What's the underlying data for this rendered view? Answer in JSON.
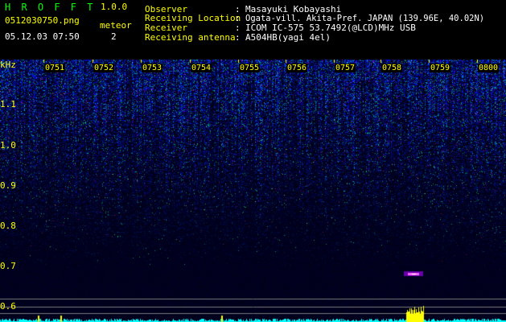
{
  "header": {
    "app_title": "H R O F F T",
    "app_version": "1.0.0",
    "file_name": "0512030750.png",
    "datetime": "05.12.03 07:50",
    "meteor_label": "meteor",
    "meteor_count": "2",
    "fields": [
      {
        "label": "Observer",
        "value": "Masayuki Kobayashi"
      },
      {
        "label": "Receiving Location",
        "value": "Ogata-vill. Akita-Pref. JAPAN (139.96E, 40.02N)"
      },
      {
        "label": "Receiver",
        "value": "ICOM IC-575 53.7492(@LCD)MHz USB"
      },
      {
        "label": "Receiving antenna",
        "value": "A504HB(yagi 4el)"
      }
    ],
    "separator": ":"
  },
  "spectrogram": {
    "y_unit": "kHz",
    "y_ticks": [
      "1.1",
      "1.0",
      "0.9",
      "0.8",
      "0.7",
      "0.6"
    ],
    "x_ticks": [
      "0751",
      "0752",
      "0753",
      "0754",
      "0755",
      "0756",
      "0757",
      "0758",
      "0759",
      "0800"
    ],
    "colors": {
      "label": "#ffff00",
      "marker": "#ffff00",
      "base": "#00ffff",
      "meteor": "#ff66ff"
    }
  }
}
